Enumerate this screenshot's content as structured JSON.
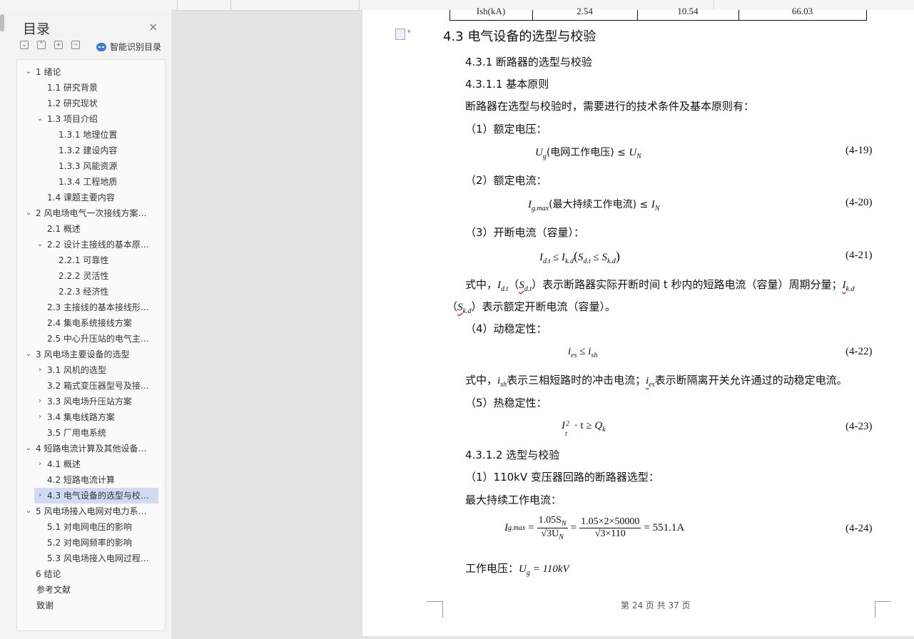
{
  "sidebar": {
    "title": "目录",
    "close_icon": "×",
    "toolbar": {
      "collapse_all": "⌄",
      "expand_up": "⌃",
      "add": "+",
      "remove": "−"
    },
    "ai_toc_label": "智能识别目录",
    "toc": [
      {
        "text": "1   绪论",
        "level": 0,
        "arrow": "⌄"
      },
      {
        "text": "1.1  研究背景",
        "level": 1,
        "arrow": ""
      },
      {
        "text": "1.2  研究现状",
        "level": 1,
        "arrow": ""
      },
      {
        "text": "1.3  项目介绍",
        "level": 1,
        "arrow": "⌄"
      },
      {
        "text": "1.3.1  地理位置",
        "level": 2,
        "arrow": ""
      },
      {
        "text": "1.3.2  建设内容",
        "level": 2,
        "arrow": ""
      },
      {
        "text": "1.3.3  风能资源",
        "level": 2,
        "arrow": ""
      },
      {
        "text": "1.3.4  工程地质",
        "level": 2,
        "arrow": ""
      },
      {
        "text": "1.4  课题主要内容",
        "level": 1,
        "arrow": ""
      },
      {
        "text": "2   风电场电气一次接线方案…",
        "level": 0,
        "arrow": "⌄"
      },
      {
        "text": "2.1  概述",
        "level": 1,
        "arrow": ""
      },
      {
        "text": "2.2  设计主接线的基本原…",
        "level": 1,
        "arrow": "⌄"
      },
      {
        "text": "2.2.1  可靠性",
        "level": 2,
        "arrow": ""
      },
      {
        "text": "2.2.2  灵活性",
        "level": 2,
        "arrow": ""
      },
      {
        "text": "2.2.3  经济性",
        "level": 2,
        "arrow": ""
      },
      {
        "text": "2.3  主接线的基本接线形…",
        "level": 1,
        "arrow": ""
      },
      {
        "text": "2.4  集电系统接线方案",
        "level": 1,
        "arrow": ""
      },
      {
        "text": "2.5  中心升压站的电气主…",
        "level": 1,
        "arrow": ""
      },
      {
        "text": "3   风电场主要设备的选型",
        "level": 0,
        "arrow": "⌄"
      },
      {
        "text": "3.1  风机的选型",
        "level": 1,
        "arrow": "›"
      },
      {
        "text": "3.2  箱式变压器型号及接…",
        "level": 1,
        "arrow": ""
      },
      {
        "text": "3.3  风电场升压站方案",
        "level": 1,
        "arrow": "›"
      },
      {
        "text": "3.4  集电线路方案",
        "level": 1,
        "arrow": "›"
      },
      {
        "text": "3.5  厂用电系统",
        "level": 1,
        "arrow": ""
      },
      {
        "text": "4   短路电流计算及其他设备…",
        "level": 0,
        "arrow": "⌄"
      },
      {
        "text": "4.1  概述",
        "level": 1,
        "arrow": "›"
      },
      {
        "text": "4.2  短路电流计算",
        "level": 1,
        "arrow": ""
      },
      {
        "text": "4.3  电气设备的选型与校…",
        "level": 1,
        "arrow": "›",
        "selected": true
      },
      {
        "text": "5   风电场接入电网对电力系…",
        "level": 0,
        "arrow": "⌄"
      },
      {
        "text": "5.1  对电网电压的影响",
        "level": 1,
        "arrow": ""
      },
      {
        "text": "5.2  对电网频率的影响",
        "level": 1,
        "arrow": ""
      },
      {
        "text": "5.3  风电场接入电网过程…",
        "level": 1,
        "arrow": ""
      },
      {
        "text": "6   结论",
        "level": 0,
        "arrow": ""
      },
      {
        "text": "参考文献",
        "level": -1,
        "arrow": ""
      },
      {
        "text": "致谢",
        "level": -1,
        "arrow": ""
      }
    ]
  },
  "document": {
    "table_row": {
      "label": "Ish(kA)",
      "v1": "2.54",
      "v2": "10.54",
      "v3": "66.03"
    },
    "h_4_3": "4.3  电气设备的选型与校验",
    "h_4_3_1": "4.3.1  断路器的选型与校验",
    "h_4_3_1_1": "4.3.1.1  基本原则",
    "p_intro": "断路器在选型与校验时，需要进行的技术条件及基本原则有：",
    "item1": "（1）额定电压：",
    "eq19": {
      "left": "U",
      "left_sub": "g",
      "mid": "(电网工作电压) ≤ ",
      "right": "U",
      "right_sub": "N",
      "num": "(4-19)"
    },
    "item2": "（2）额定电流：",
    "eq20": {
      "left": "I",
      "left_sub": "g.max",
      "mid": "(最大持续工作电流) ≤ ",
      "right": "I",
      "right_sub": "N",
      "num": "(4-20)"
    },
    "item3": "（3）开断电流（容量）：",
    "eq21": {
      "expr_a": "I",
      "sub_a": "d.t",
      "rel": " ≤ ",
      "expr_b": "I",
      "sub_b": "k.d",
      "paren_a": "S",
      "paren_a_sub": "d.t",
      "paren_b": "S",
      "paren_b_sub": "k.d",
      "num": "(4-21)"
    },
    "p_eq21_desc_1": "表示断路器实际开断时间 t 秒内的短路电流（容量）周期分量；",
    "p_eq21_desc_2": "表示额定开断电流（容量）。",
    "p_eq21_prefix": "式中，",
    "item4": "（4）动稳定性：",
    "eq22": {
      "left": "i",
      "left_sub": "es",
      "rel": " ≤ ",
      "right": "i",
      "right_sub": "sh",
      "num": "(4-22)"
    },
    "p_eq22_prefix": "式中，",
    "p_eq22_mid": "表示三相短路时的冲击电流；",
    "p_eq22_end": "表示断隔离开关允许通过的动稳定电流。",
    "item5": "（5）热稳定性：",
    "eq23": {
      "left": "I",
      "left_sub": "t",
      "left_sup": "2",
      "mid": " · t ≥ ",
      "right": "Q",
      "right_sub": "k",
      "num": "(4-23)"
    },
    "h_4_3_1_2": "4.3.1.2  选型与校验",
    "p_110": "（1）110kV 变压器回路的断路器选型：",
    "p_maxcur": "最大持续工作电流：",
    "eq24": {
      "lhs": "I",
      "lhs_sub": "g.max",
      "f1_num": "1.05S",
      "f1_num_sub": "N",
      "f1_den": "√3U",
      "f1_den_sub": "N",
      "f2_num": "1.05×2×50000",
      "f2_den": "√3×110",
      "result": "= 551.1A",
      "num": "(4-24)"
    },
    "p_workv_label": "工作电压：",
    "p_workv_eq": "U",
    "p_workv_sub": "g",
    "p_workv_val": " = 110kV",
    "footer": "第 24 页 共 37 页"
  }
}
